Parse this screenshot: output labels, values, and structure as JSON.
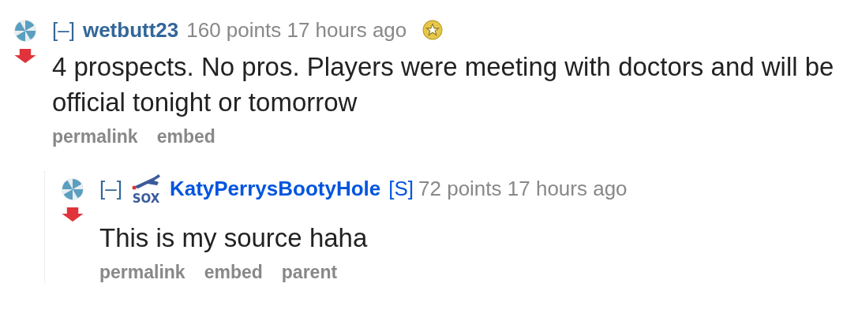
{
  "comments": [
    {
      "collapse": "[–]",
      "author": "wetbutt23",
      "submitter": false,
      "score": "160 points",
      "time": "17 hours ago",
      "gilded": true,
      "downvoted": true,
      "body": "4 prospects. No pros. Players were meeting with doctors and will be official tonight or tomorrow",
      "links": [
        "permalink",
        "embed"
      ],
      "children": [
        {
          "collapse": "[–]",
          "author": "KatyPerrysBootyHole",
          "submitter": true,
          "submitter_label": "[S]",
          "flair": "SOX",
          "score": "72 points",
          "time": "17 hours ago",
          "downvoted": true,
          "body": "This is my source haha",
          "links": [
            "permalink",
            "embed",
            "parent"
          ]
        }
      ]
    }
  ]
}
